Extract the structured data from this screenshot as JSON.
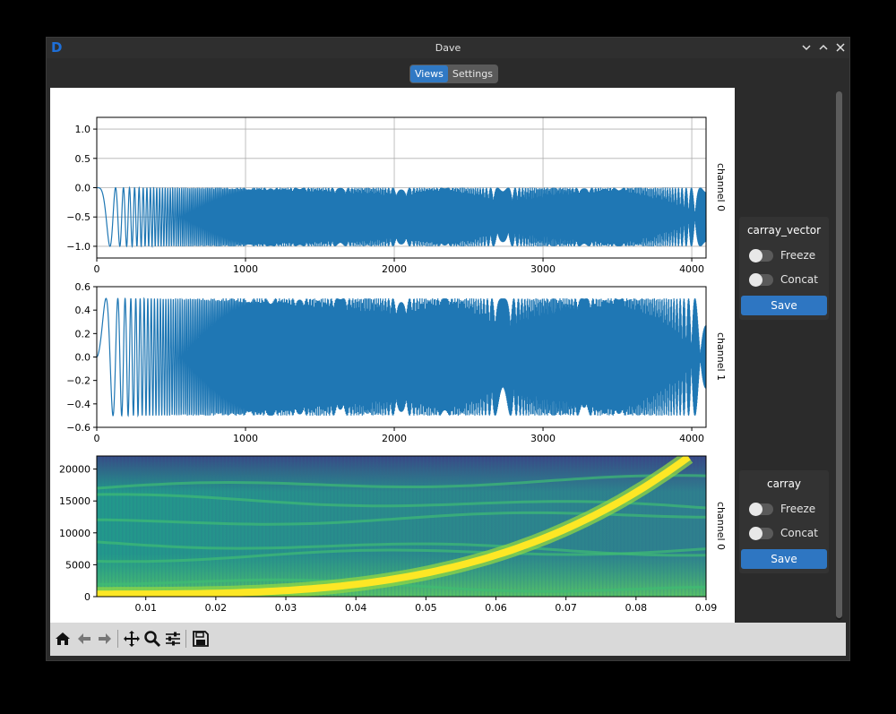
{
  "window": {
    "title": "Dave",
    "logo_glyph": "D",
    "controls": [
      "chevron-down-icon",
      "chevron-up-icon",
      "close-icon"
    ]
  },
  "tabs": [
    {
      "label": "Views",
      "active": true
    },
    {
      "label": "Settings",
      "active": false
    }
  ],
  "colors": {
    "accent": "#3079c4",
    "button": "#2e76c2",
    "line": "#1f77b4",
    "background": "#2b2b2b"
  },
  "plots": [
    {
      "label": "channel 0",
      "x_ticks": [
        "0",
        "1000",
        "2000",
        "3000",
        "4000"
      ],
      "y_ticks": [
        "1.0",
        "0.5",
        "0.0",
        "−0.5",
        "−1.0"
      ]
    },
    {
      "label": "channel 1",
      "x_ticks": [
        "0",
        "1000",
        "2000",
        "3000",
        "4000"
      ],
      "y_ticks": [
        "0.6",
        "0.4",
        "0.2",
        "0.0",
        "−0.2",
        "−0.4",
        "−0.6"
      ]
    },
    {
      "label": "channel 0",
      "x_ticks": [
        "0.01",
        "0.02",
        "0.03",
        "0.04",
        "0.05",
        "0.06",
        "0.07",
        "0.08",
        "0.09"
      ],
      "y_ticks": [
        "20000",
        "15000",
        "10000",
        "5000",
        "0"
      ]
    }
  ],
  "chart_data": [
    {
      "type": "line",
      "series": [
        {
          "kind": "chirp",
          "amplitude_min": -1.0,
          "amplitude_max": 0.0
        }
      ],
      "xlim": [
        0,
        4096
      ],
      "ylim": [
        -1.2,
        1.2
      ],
      "grid": true,
      "ylabel": "channel 0"
    },
    {
      "type": "line",
      "series": [
        {
          "kind": "chirp",
          "amplitude_min": -0.5,
          "amplitude_max": 0.5
        }
      ],
      "xlim": [
        0,
        4096
      ],
      "ylim": [
        -0.6,
        0.6
      ],
      "grid": false,
      "ylabel": "channel 1"
    },
    {
      "type": "heatmap",
      "xlim": [
        0.003,
        0.09
      ],
      "ylim": [
        0,
        22050
      ],
      "colormap": "viridis",
      "ylabel": "channel 0"
    }
  ],
  "toolbar": {
    "tools": [
      "home-icon",
      "back-icon",
      "forward-icon",
      "pan-icon",
      "zoom-icon",
      "configure-subplots-icon",
      "save-figure-icon"
    ]
  },
  "controls": [
    {
      "title": "carray_vector",
      "freeze_label": "Freeze",
      "concat_label": "Concat",
      "save_label": "Save",
      "freeze_on": false,
      "concat_on": false
    },
    {
      "title": "carray",
      "freeze_label": "Freeze",
      "concat_label": "Concat",
      "save_label": "Save",
      "freeze_on": false,
      "concat_on": false
    }
  ]
}
